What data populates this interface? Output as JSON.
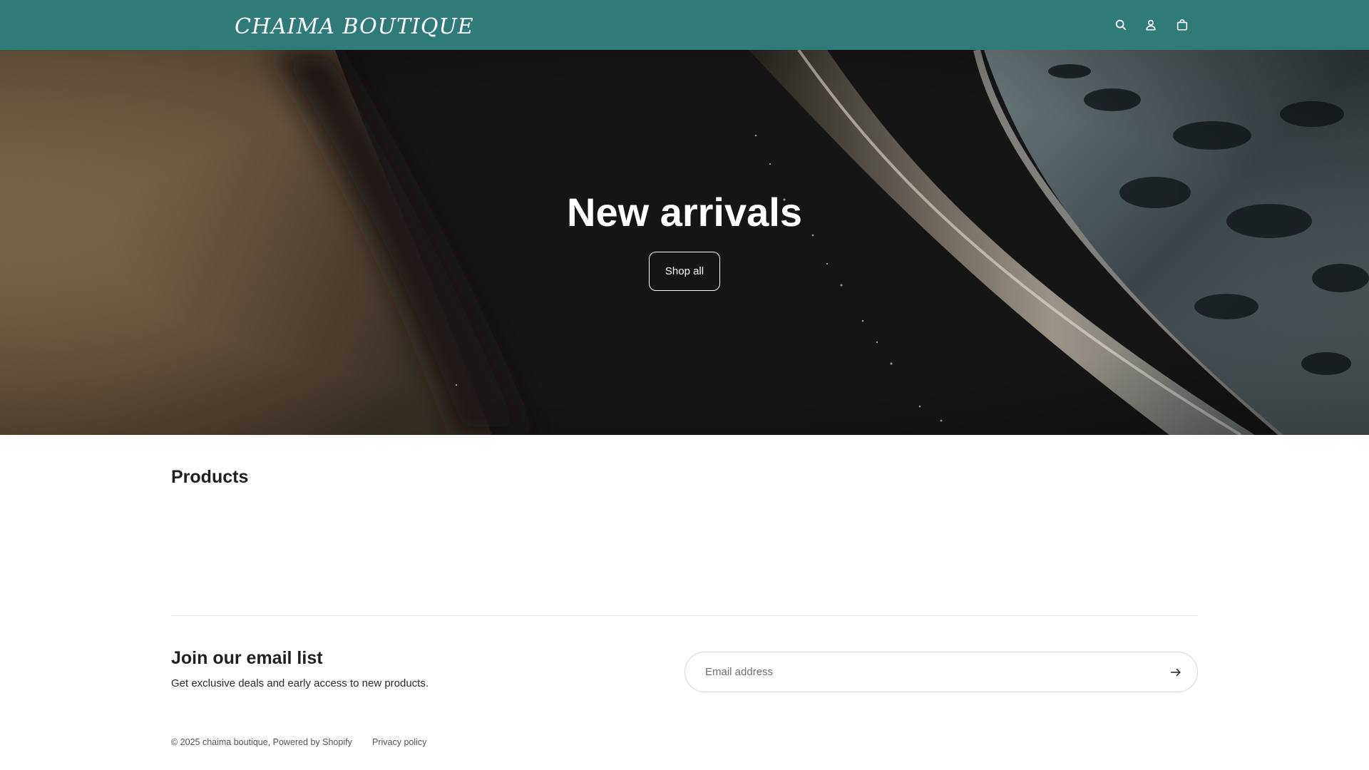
{
  "header": {
    "logo": "CHAIMA BOUTIQUE",
    "background_color": "#2f7b78",
    "icons": [
      "search-icon",
      "account-icon",
      "cart-icon"
    ]
  },
  "hero": {
    "title": "New arrivals",
    "button_label": "Shop all"
  },
  "products": {
    "title": "Products"
  },
  "newsletter": {
    "title": "Join our email list",
    "subtitle": "Get exclusive deals and early access to new products.",
    "email_placeholder": "Email address",
    "submit_icon": "arrow-right-icon"
  },
  "footer": {
    "copyright": "© 2025 chaima boutique, Powered by Shopify",
    "privacy_link": "Privacy policy"
  }
}
